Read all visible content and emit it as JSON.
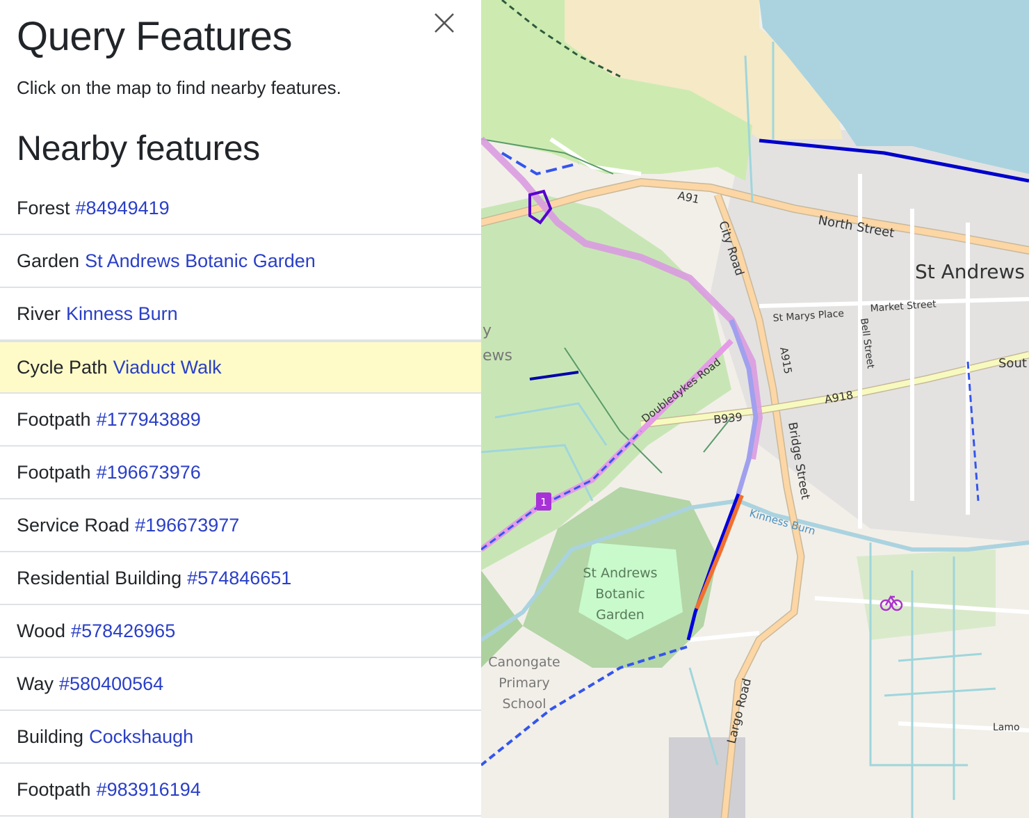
{
  "sidebar": {
    "title": "Query Features",
    "hint": "Click on the map to find nearby features.",
    "subtitle": "Nearby features",
    "close_icon": "close-icon",
    "features": [
      {
        "type": "Forest",
        "link": "#84949419"
      },
      {
        "type": "Garden",
        "link": "St Andrews Botanic Garden"
      },
      {
        "type": "River",
        "link": "Kinness Burn"
      },
      {
        "type": "Cycle Path",
        "link": "Viaduct Walk",
        "highlighted": true
      },
      {
        "type": "Footpath",
        "link": "#177943889"
      },
      {
        "type": "Footpath",
        "link": "#196673976"
      },
      {
        "type": "Service Road",
        "link": "#196673977"
      },
      {
        "type": "Residential Building",
        "link": "#574846651"
      },
      {
        "type": "Wood",
        "link": "#578426965"
      },
      {
        "type": "Way",
        "link": "#580400564"
      },
      {
        "type": "Building",
        "link": "Cockshaugh"
      },
      {
        "type": "Footpath",
        "link": "#983916194"
      }
    ]
  },
  "map": {
    "labels": {
      "town": "St Andrews",
      "a91": "A91",
      "north_street": "North Street",
      "city_road": "City Road",
      "st_marys_place": "St Marys Place",
      "market_street": "Market Street",
      "bell_street": "Bell Street",
      "a915": "A915",
      "a918": "A918",
      "south": "Sout",
      "doubledykes_road": "Doubledykes Road",
      "b939": "B939",
      "bridge_street": "Bridge Street",
      "kinness_burn": "Kinness Burn",
      "botanic_garden_1": "St Andrews",
      "botanic_garden_2": "Botanic",
      "botanic_garden_3": "Garden",
      "school_1": "Canongate",
      "school_2": "Primary",
      "school_3": "School",
      "largo_road": "Largo Road",
      "lamond": "Lamo",
      "route_number": "1",
      "partial_left_1": "y",
      "partial_left_2": "ews"
    },
    "colors": {
      "sea": "#aad3df",
      "sand": "#f5e9c6",
      "park": "#c8facc",
      "wood": "#add19e",
      "residential": "#e0dfdf",
      "landuse": "#f2efe9",
      "highlight_path": "#f07030",
      "cycle_route": "#0000dd",
      "national_route": "#cc66cc"
    }
  }
}
